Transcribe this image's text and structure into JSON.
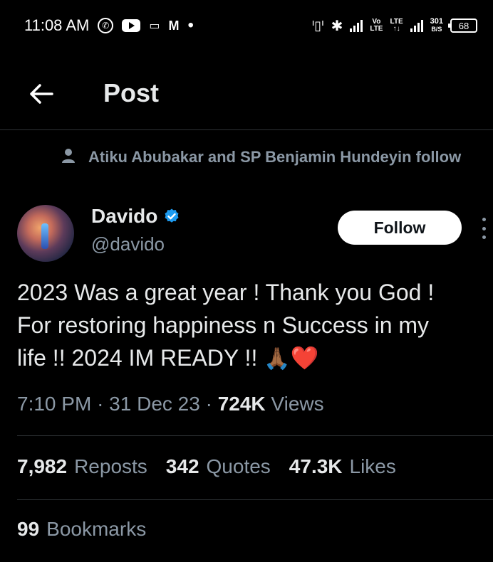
{
  "status_bar": {
    "time": "11:08 AM",
    "icons": [
      "whatsapp-icon",
      "youtube-icon",
      "gamepad-icon",
      "gmail-icon",
      "dot-icon"
    ],
    "vo_lte_top": "Vo",
    "vo_lte_bottom": "LTE",
    "lte_label": "LTE",
    "speed_value": "301",
    "speed_unit": "B/S",
    "battery": "68"
  },
  "header": {
    "title": "Post"
  },
  "social_context": {
    "text": "Atiku Abubakar and SP Benjamin Hundeyin follow"
  },
  "author": {
    "name": "Davido",
    "handle": "@davido",
    "verified": true
  },
  "follow_button": {
    "label": "Follow"
  },
  "tweet": {
    "line1": "2023 Was a great year ! Thank you God !",
    "line2": "For restoring happiness n Success in my",
    "line3": "life !!  2024 IM READY !! ",
    "emoji_pray": "🙏🏾",
    "emoji_heart": "❤️"
  },
  "meta": {
    "time": "7:10 PM",
    "date": "31 Dec 23",
    "views_count": "724K",
    "views_label": "Views",
    "separator": "·"
  },
  "stats": {
    "reposts_count": "7,982",
    "reposts_label": "Reposts",
    "quotes_count": "342",
    "quotes_label": "Quotes",
    "likes_count": "47.3K",
    "likes_label": "Likes",
    "bookmarks_count": "99",
    "bookmarks_label": "Bookmarks"
  },
  "colors": {
    "background": "#000000",
    "text_primary": "#e7e9ea",
    "text_secondary": "#8b98a5",
    "verified_blue": "#1d9bf0",
    "divider": "#2f3336"
  }
}
